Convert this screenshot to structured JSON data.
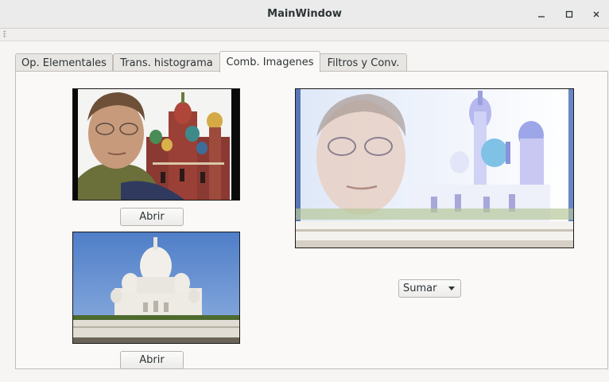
{
  "window": {
    "title": "MainWindow"
  },
  "tabs": [
    {
      "label": "Op. Elementales",
      "active": false
    },
    {
      "label": "Trans. histograma",
      "active": false
    },
    {
      "label": "Comb. Imagenes",
      "active": true
    },
    {
      "label": "Filtros y Conv.",
      "active": false
    }
  ],
  "panel": {
    "image1": {
      "open_label": "Abrir"
    },
    "image2": {
      "open_label": "Abrir"
    },
    "operation": {
      "selected": "Sumar"
    }
  },
  "colors": {
    "sky": "#5b86c9",
    "background": "#fbf9f7"
  },
  "icons": [
    "minimize-icon",
    "maximize-icon",
    "close-icon",
    "dropdown-arrow-icon"
  ]
}
